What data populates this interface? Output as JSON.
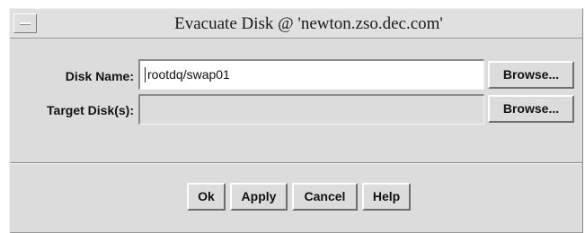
{
  "window": {
    "title": "Evacuate Disk @ 'newton.zso.dec.com'"
  },
  "form": {
    "disk_name_label": "Disk Name:",
    "disk_name_value": "rootdq/swap01",
    "target_disks_label": "Target Disk(s):",
    "target_disks_value": "",
    "browse_label": "Browse..."
  },
  "actions": {
    "ok": "Ok",
    "apply": "Apply",
    "cancel": "Cancel",
    "help": "Help"
  },
  "colors": {
    "dialog_background": "#dcdcdc",
    "input_background": "#ffffff"
  },
  "icons": {
    "window_menu": "window-menu-icon"
  }
}
